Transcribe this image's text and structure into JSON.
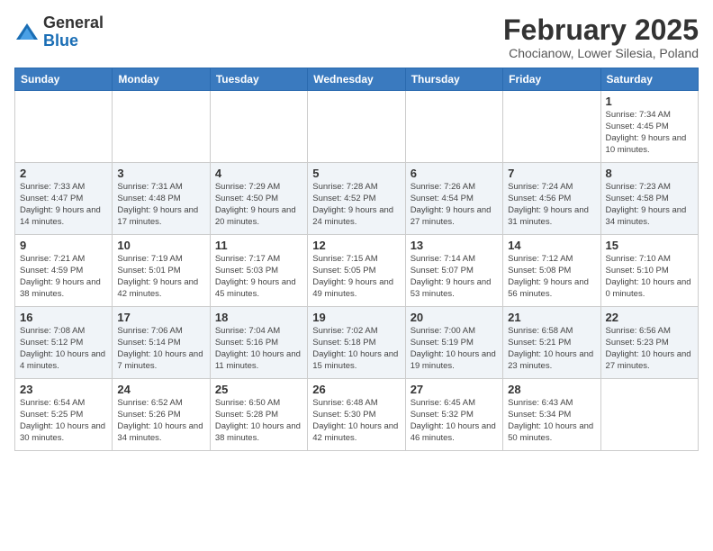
{
  "header": {
    "logo_line1": "General",
    "logo_line2": "Blue",
    "month": "February 2025",
    "location": "Chocianow, Lower Silesia, Poland"
  },
  "days_of_week": [
    "Sunday",
    "Monday",
    "Tuesday",
    "Wednesday",
    "Thursday",
    "Friday",
    "Saturday"
  ],
  "weeks": [
    [
      {
        "day": "",
        "info": ""
      },
      {
        "day": "",
        "info": ""
      },
      {
        "day": "",
        "info": ""
      },
      {
        "day": "",
        "info": ""
      },
      {
        "day": "",
        "info": ""
      },
      {
        "day": "",
        "info": ""
      },
      {
        "day": "1",
        "info": "Sunrise: 7:34 AM\nSunset: 4:45 PM\nDaylight: 9 hours and 10 minutes."
      }
    ],
    [
      {
        "day": "2",
        "info": "Sunrise: 7:33 AM\nSunset: 4:47 PM\nDaylight: 9 hours and 14 minutes."
      },
      {
        "day": "3",
        "info": "Sunrise: 7:31 AM\nSunset: 4:48 PM\nDaylight: 9 hours and 17 minutes."
      },
      {
        "day": "4",
        "info": "Sunrise: 7:29 AM\nSunset: 4:50 PM\nDaylight: 9 hours and 20 minutes."
      },
      {
        "day": "5",
        "info": "Sunrise: 7:28 AM\nSunset: 4:52 PM\nDaylight: 9 hours and 24 minutes."
      },
      {
        "day": "6",
        "info": "Sunrise: 7:26 AM\nSunset: 4:54 PM\nDaylight: 9 hours and 27 minutes."
      },
      {
        "day": "7",
        "info": "Sunrise: 7:24 AM\nSunset: 4:56 PM\nDaylight: 9 hours and 31 minutes."
      },
      {
        "day": "8",
        "info": "Sunrise: 7:23 AM\nSunset: 4:58 PM\nDaylight: 9 hours and 34 minutes."
      }
    ],
    [
      {
        "day": "9",
        "info": "Sunrise: 7:21 AM\nSunset: 4:59 PM\nDaylight: 9 hours and 38 minutes."
      },
      {
        "day": "10",
        "info": "Sunrise: 7:19 AM\nSunset: 5:01 PM\nDaylight: 9 hours and 42 minutes."
      },
      {
        "day": "11",
        "info": "Sunrise: 7:17 AM\nSunset: 5:03 PM\nDaylight: 9 hours and 45 minutes."
      },
      {
        "day": "12",
        "info": "Sunrise: 7:15 AM\nSunset: 5:05 PM\nDaylight: 9 hours and 49 minutes."
      },
      {
        "day": "13",
        "info": "Sunrise: 7:14 AM\nSunset: 5:07 PM\nDaylight: 9 hours and 53 minutes."
      },
      {
        "day": "14",
        "info": "Sunrise: 7:12 AM\nSunset: 5:08 PM\nDaylight: 9 hours and 56 minutes."
      },
      {
        "day": "15",
        "info": "Sunrise: 7:10 AM\nSunset: 5:10 PM\nDaylight: 10 hours and 0 minutes."
      }
    ],
    [
      {
        "day": "16",
        "info": "Sunrise: 7:08 AM\nSunset: 5:12 PM\nDaylight: 10 hours and 4 minutes."
      },
      {
        "day": "17",
        "info": "Sunrise: 7:06 AM\nSunset: 5:14 PM\nDaylight: 10 hours and 7 minutes."
      },
      {
        "day": "18",
        "info": "Sunrise: 7:04 AM\nSunset: 5:16 PM\nDaylight: 10 hours and 11 minutes."
      },
      {
        "day": "19",
        "info": "Sunrise: 7:02 AM\nSunset: 5:18 PM\nDaylight: 10 hours and 15 minutes."
      },
      {
        "day": "20",
        "info": "Sunrise: 7:00 AM\nSunset: 5:19 PM\nDaylight: 10 hours and 19 minutes."
      },
      {
        "day": "21",
        "info": "Sunrise: 6:58 AM\nSunset: 5:21 PM\nDaylight: 10 hours and 23 minutes."
      },
      {
        "day": "22",
        "info": "Sunrise: 6:56 AM\nSunset: 5:23 PM\nDaylight: 10 hours and 27 minutes."
      }
    ],
    [
      {
        "day": "23",
        "info": "Sunrise: 6:54 AM\nSunset: 5:25 PM\nDaylight: 10 hours and 30 minutes."
      },
      {
        "day": "24",
        "info": "Sunrise: 6:52 AM\nSunset: 5:26 PM\nDaylight: 10 hours and 34 minutes."
      },
      {
        "day": "25",
        "info": "Sunrise: 6:50 AM\nSunset: 5:28 PM\nDaylight: 10 hours and 38 minutes."
      },
      {
        "day": "26",
        "info": "Sunrise: 6:48 AM\nSunset: 5:30 PM\nDaylight: 10 hours and 42 minutes."
      },
      {
        "day": "27",
        "info": "Sunrise: 6:45 AM\nSunset: 5:32 PM\nDaylight: 10 hours and 46 minutes."
      },
      {
        "day": "28",
        "info": "Sunrise: 6:43 AM\nSunset: 5:34 PM\nDaylight: 10 hours and 50 minutes."
      },
      {
        "day": "",
        "info": ""
      }
    ]
  ]
}
